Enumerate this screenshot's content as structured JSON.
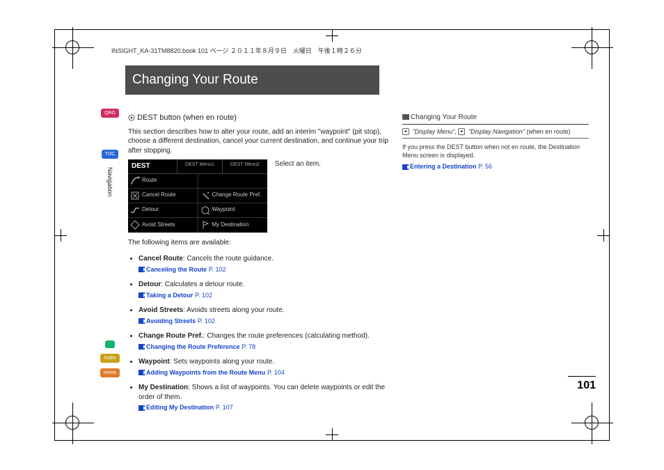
{
  "print_header": "INSIGHT_KA-31TM8820.book  101 ページ  ２０１１年８月９日　火曜日　午後１時２６分",
  "title": "Changing Your Route",
  "side_tabs": {
    "qrg": "QRG",
    "toc": "TOC",
    "voice": "",
    "index": "Index",
    "home": "Home"
  },
  "section_name": "Navigation",
  "subhead_icon": "dest-button-icon",
  "subhead": "DEST button (when en route)",
  "intro": "This section describes how to alter your route, add an interim \"waypoint\" (pit stop), choose a different destination, cancel your current destination, and continue your trip after stopping.",
  "select_item": "Select an item.",
  "screenshot": {
    "tabs": {
      "t1": "DEST",
      "t2": "DEST Menu1",
      "t3": "DEST Menu2"
    },
    "rows": [
      {
        "left": "Route",
        "right": ""
      },
      {
        "left": "Cancel Route",
        "right": "Change Route Pref."
      },
      {
        "left": "Detour",
        "right": "Waypoint"
      },
      {
        "left": "Avoid Streets",
        "right": "My Destination"
      }
    ]
  },
  "items_intro": "The following items are available:",
  "items": [
    {
      "name": "Cancel Route",
      "desc": ": Cancels the route guidance.",
      "xref": "Canceling the Route",
      "page": "P. 102"
    },
    {
      "name": "Detour",
      "desc": ": Calculates a detour route.",
      "xref": "Taking a Detour",
      "page": "P. 102"
    },
    {
      "name": "Avoid Streets",
      "desc": ": Avoids streets along your route.",
      "xref": "Avoiding Streets",
      "page": "P. 102"
    },
    {
      "name": "Change Route Pref.",
      "desc": ": Changes the route preferences (calculating method).",
      "xref": "Changing the Route Preference",
      "page": "P. 78"
    },
    {
      "name": "Waypoint",
      "desc": ": Sets waypoints along your route.",
      "xref": "Adding Waypoints from the Route Menu",
      "page": "P. 104"
    },
    {
      "name": "My Destination",
      "desc": ": Shows a list of waypoints. You can delete waypoints or edit the order of them.",
      "xref": "Editing My Destination",
      "page": "P. 107"
    }
  ],
  "aside": {
    "head": "Changing Your Route",
    "voice1": "\"Display Menu\"",
    "voice_sep": ", ",
    "voice2": "\"Display Navigation\"",
    "voice_suffix": " (when en route)",
    "p1": "If you press the DEST button when not en route, the Destination Menu screen is displayed.",
    "xref": "Entering a Destination",
    "page": "P. 56"
  },
  "page_num": "101"
}
